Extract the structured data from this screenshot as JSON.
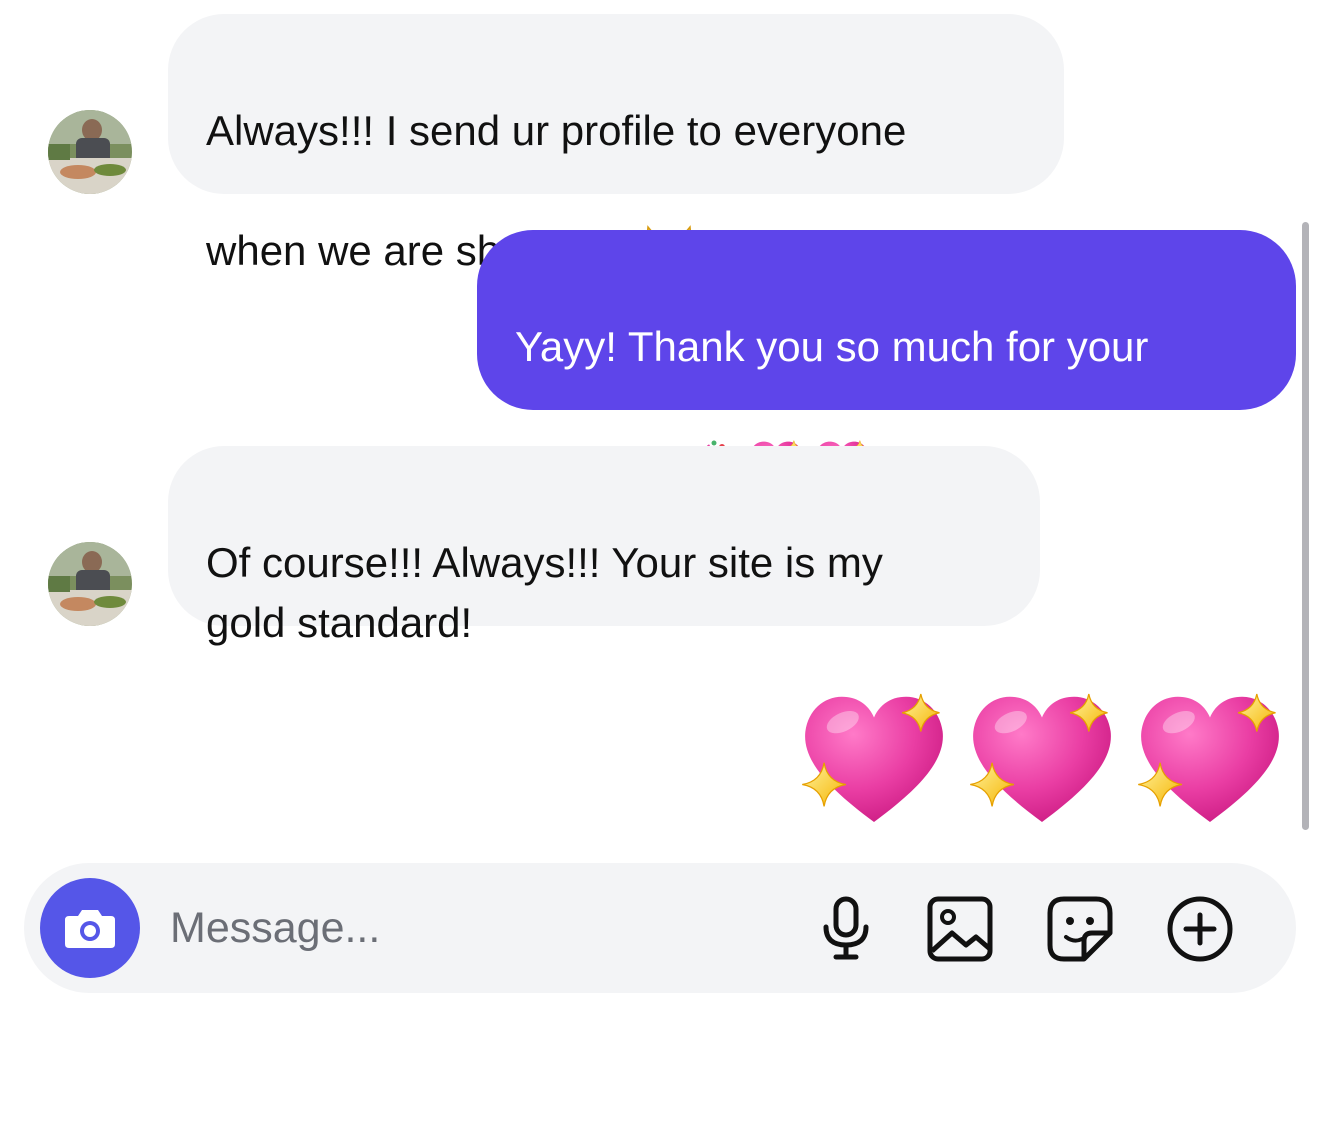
{
  "conversation": {
    "messages": [
      {
        "sender": "them",
        "text": "Always!!! I send ur profile to everyone\nwhen we are shopping",
        "emoji": "face-with-tears-of-joy-cat"
      },
      {
        "sender": "me",
        "text": "Yayy! Thank you so much for your\nsupport!!",
        "emoji": [
          "party-popper",
          "sparkling-heart",
          "sparkling-heart"
        ]
      },
      {
        "sender": "them",
        "text": "Of course!!! Always!!! Your site is my\ngold standard!"
      },
      {
        "sender": "me",
        "emoji": [
          "sparkling-heart",
          "sparkling-heart",
          "sparkling-heart"
        ]
      }
    ]
  },
  "composer": {
    "placeholder": "Message...",
    "camera_icon": "camera-icon",
    "tools": [
      "microphone-icon",
      "image-icon",
      "sticker-icon",
      "plus-circle-icon"
    ]
  },
  "colors": {
    "incoming_bubble": "#f3f4f6",
    "outgoing_bubble": "#5e45ea",
    "camera_button": "#5556e8",
    "composer_bg": "#f3f4f6",
    "heart": "#e23d9c"
  }
}
